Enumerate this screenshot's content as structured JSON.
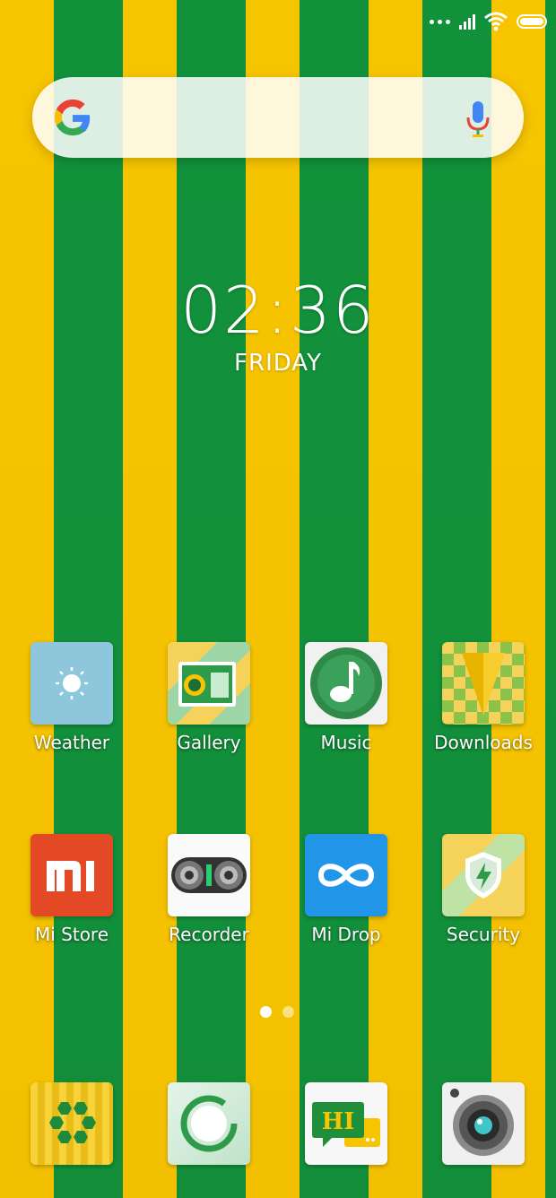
{
  "status_bar": {
    "icons": [
      "more-dots-icon",
      "signal-icon",
      "wifi-icon",
      "battery-icon"
    ]
  },
  "search": {
    "icon_left": "google-g-icon",
    "icon_right": "microphone-icon"
  },
  "clock": {
    "time": "02:36",
    "day": "FRIDAY"
  },
  "apps_row1": [
    {
      "label": "Weather",
      "icon": "weather-sun-icon"
    },
    {
      "label": "Gallery",
      "icon": "gallery-icon"
    },
    {
      "label": "Music",
      "icon": "music-note-icon"
    },
    {
      "label": "Downloads",
      "icon": "downloads-arrow-icon"
    }
  ],
  "apps_row2": [
    {
      "label": "Mi Store",
      "icon": "mi-store-icon"
    },
    {
      "label": "Recorder",
      "icon": "recorder-icon"
    },
    {
      "label": "Mi Drop",
      "icon": "mi-drop-infinity-icon"
    },
    {
      "label": "Security",
      "icon": "security-shield-icon"
    }
  ],
  "dock": [
    {
      "icon": "themes-hexagon-icon"
    },
    {
      "icon": "cleaner-ring-icon"
    },
    {
      "icon": "messaging-hi-icon"
    },
    {
      "icon": "camera-lens-icon"
    }
  ],
  "pager": {
    "pages": 2,
    "current": 1
  },
  "colors": {
    "yellow": "#f7c400",
    "green": "#12913b"
  }
}
